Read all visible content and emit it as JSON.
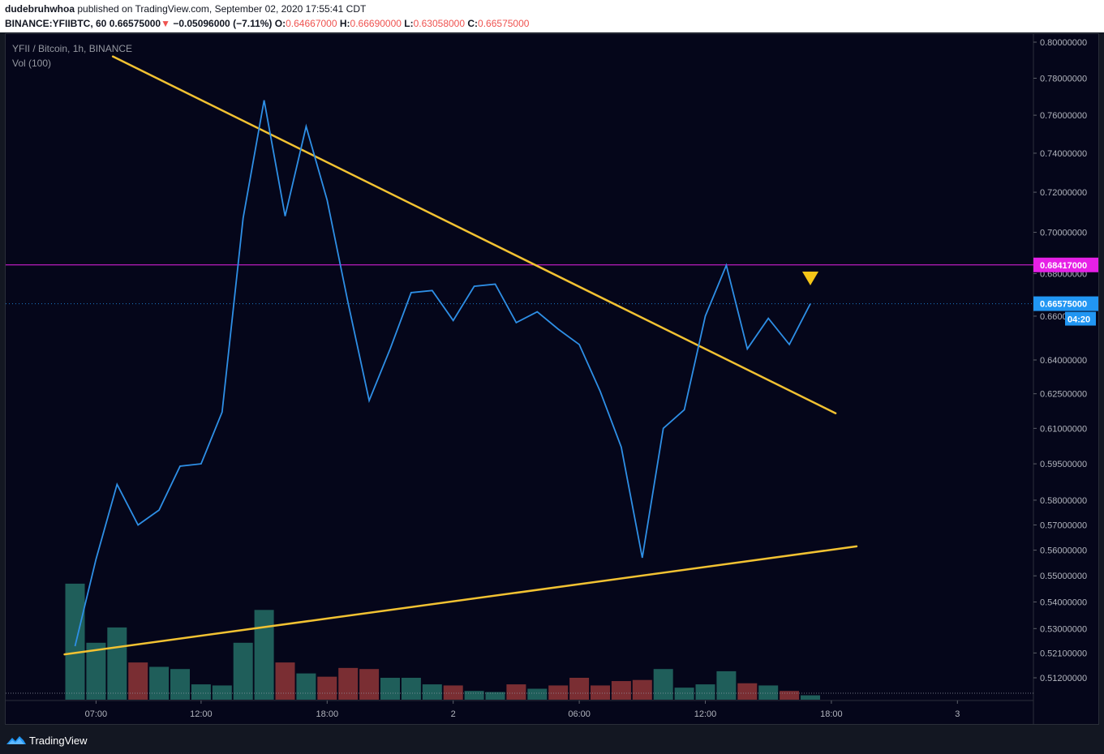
{
  "header": {
    "author": "dudebruhwhoa",
    "published_text": "published on TradingView.com, September 02, 2020 17:55:41 CDT",
    "symbol": "BINANCE:YFIIBTC, 60",
    "last_price": "0.66575000",
    "arrow": "▼",
    "change": "−0.05096000 (−7.11%)",
    "o_label": "O:",
    "o_value": "0.64667000",
    "h_label": "H:",
    "h_value": "0.66690000",
    "l_label": "L:",
    "l_value": "0.63058000",
    "c_label": "C:",
    "c_value": "0.66575000"
  },
  "legend": {
    "title": "YFII / Bitcoin, 1h, BINANCE",
    "volume": "Vol (100)"
  },
  "footer": {
    "brand": "TradingView"
  },
  "colors": {
    "price_line": "#2e8fe6",
    "trendline": "#f2c232",
    "magenta_line": "#e620e6",
    "volume_up": "#1f5e5a",
    "volume_down": "#7a2e33",
    "price_label_bg": "#2196f3",
    "background": "#05061a"
  },
  "chart_data": {
    "type": "line",
    "symbol": "YFII / Bitcoin",
    "interval": "1h",
    "scale": "log",
    "x_labels": [
      "07:00",
      "12:00",
      "18:00",
      "2",
      "06:00",
      "12:00",
      "18:00",
      "3"
    ],
    "y_labels": [
      "0.80000000",
      "0.78000000",
      "0.76000000",
      "0.74000000",
      "0.72000000",
      "0.70000000",
      "0.68000000",
      "0.66000000",
      "0.64000000",
      "0.62500000",
      "0.61000000",
      "0.59500000",
      "0.58000000",
      "0.57000000",
      "0.56000000",
      "0.55000000",
      "0.54000000",
      "0.53000000",
      "0.52100000",
      "0.51200000"
    ],
    "series": [
      {
        "values": [
          0.5235,
          0.5565,
          0.5865,
          0.57,
          0.576,
          0.594,
          0.595,
          0.617,
          0.707,
          0.768,
          0.708,
          0.754,
          0.716,
          0.666,
          0.622,
          0.645,
          0.671,
          0.672,
          0.658,
          0.674,
          0.675,
          0.657,
          0.662,
          0.654,
          0.647,
          0.626,
          0.602,
          0.557,
          0.61,
          0.618,
          0.66,
          0.684,
          0.645,
          0.659,
          0.647,
          0.6658
        ]
      }
    ],
    "volume": [
      {
        "v": 0.53,
        "up": true
      },
      {
        "v": 0.26,
        "up": true
      },
      {
        "v": 0.33,
        "up": true
      },
      {
        "v": 0.17,
        "up": false
      },
      {
        "v": 0.15,
        "up": true
      },
      {
        "v": 0.14,
        "up": true
      },
      {
        "v": 0.07,
        "up": true
      },
      {
        "v": 0.065,
        "up": true
      },
      {
        "v": 0.26,
        "up": true
      },
      {
        "v": 0.41,
        "up": true
      },
      {
        "v": 0.17,
        "up": false
      },
      {
        "v": 0.12,
        "up": true
      },
      {
        "v": 0.105,
        "up": false
      },
      {
        "v": 0.145,
        "up": false
      },
      {
        "v": 0.14,
        "up": false
      },
      {
        "v": 0.1,
        "up": true
      },
      {
        "v": 0.1,
        "up": true
      },
      {
        "v": 0.07,
        "up": true
      },
      {
        "v": 0.065,
        "up": false
      },
      {
        "v": 0.04,
        "up": true
      },
      {
        "v": 0.035,
        "up": true
      },
      {
        "v": 0.07,
        "up": false
      },
      {
        "v": 0.05,
        "up": true
      },
      {
        "v": 0.065,
        "up": false
      },
      {
        "v": 0.1,
        "up": false
      },
      {
        "v": 0.065,
        "up": false
      },
      {
        "v": 0.085,
        "up": false
      },
      {
        "v": 0.09,
        "up": false
      },
      {
        "v": 0.14,
        "up": true
      },
      {
        "v": 0.055,
        "up": true
      },
      {
        "v": 0.07,
        "up": true
      },
      {
        "v": 0.13,
        "up": true
      },
      {
        "v": 0.075,
        "up": false
      },
      {
        "v": 0.065,
        "up": true
      },
      {
        "v": 0.04,
        "up": false
      },
      {
        "v": 0.02,
        "up": true
      }
    ],
    "horizontal_line": {
      "price": 0.68417,
      "label": "0.68417000"
    },
    "current_price": {
      "label": "0.66575000",
      "countdown": "04:20"
    },
    "trendlines": [
      {
        "from": [
          1.8,
          0.792
        ],
        "to": [
          36.2,
          0.6165
        ]
      },
      {
        "from": [
          -0.5,
          0.5205
        ],
        "to": [
          37.2,
          0.5615
        ]
      }
    ],
    "marker": {
      "type": "triangle-down",
      "index": 35,
      "price": 0.6775
    }
  }
}
